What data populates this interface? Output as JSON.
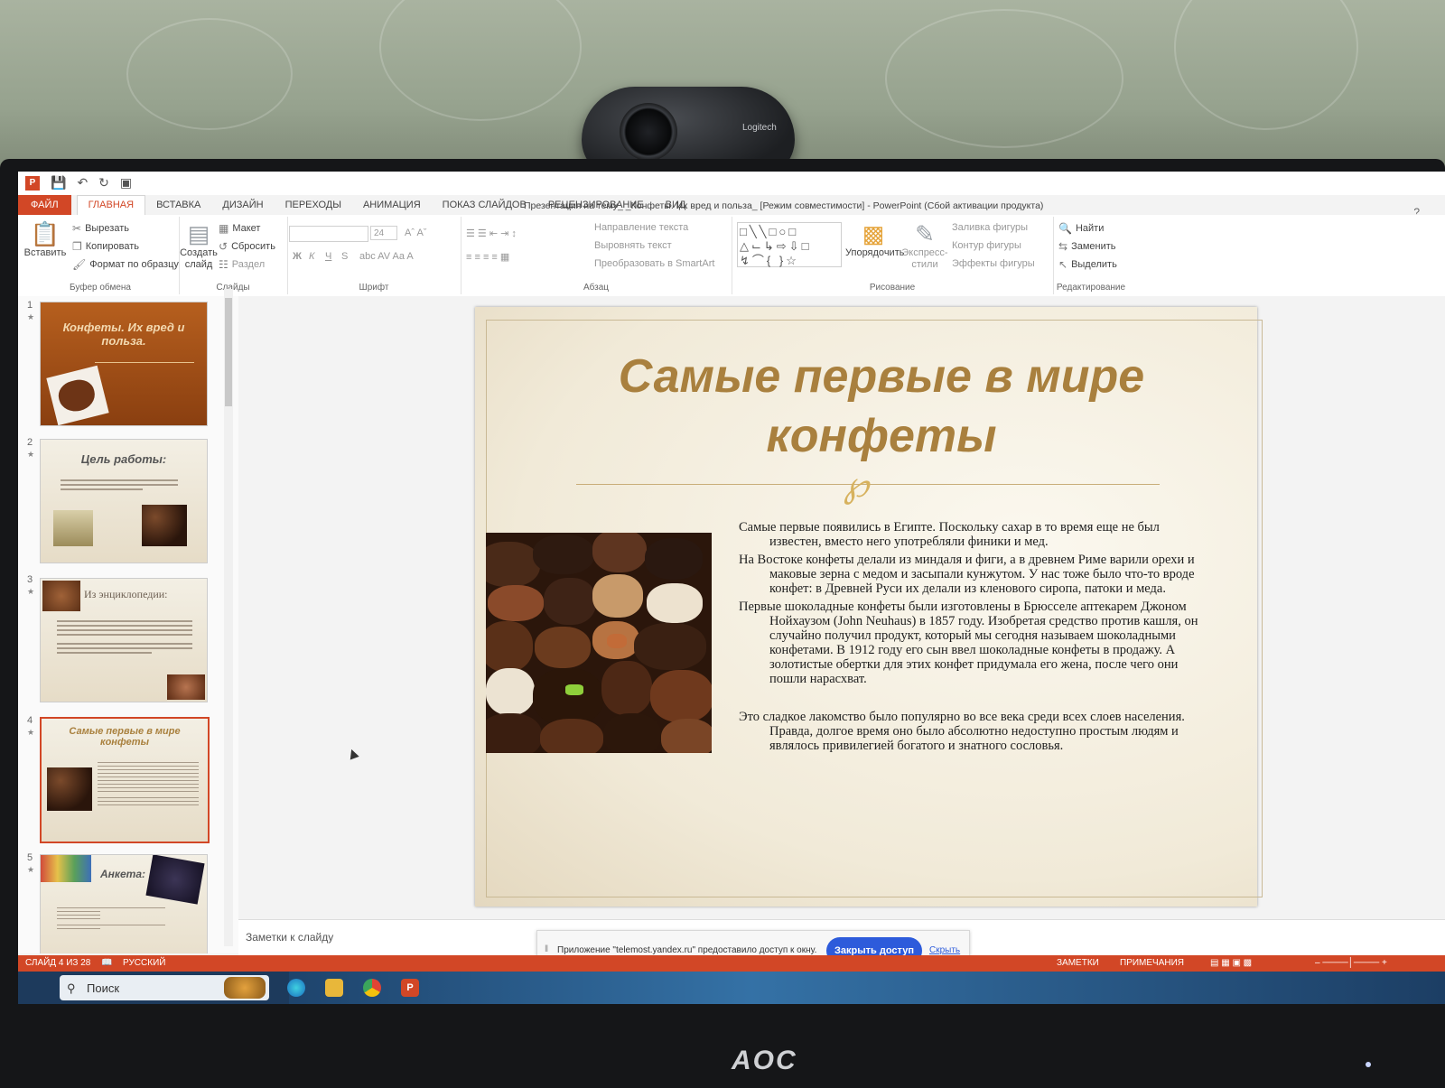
{
  "window": {
    "title": "Презентация на тему_ _Конфеты. Их вред и польза_ [Режим совместимости] - PowerPoint (Сбой активации продукта)",
    "help": "?"
  },
  "tabs": [
    "ФАЙЛ",
    "ГЛАВНАЯ",
    "ВСТАВКА",
    "ДИЗАЙН",
    "ПЕРЕХОДЫ",
    "АНИМАЦИЯ",
    "ПОКАЗ СЛАЙДОВ",
    "РЕЦЕНЗИРОВАНИЕ",
    "ВИД"
  ],
  "ribbon": {
    "clipboard": {
      "paste": "Вставить",
      "cut": "Вырезать",
      "copy": "Копировать",
      "format": "Формат по образцу",
      "label": "Буфер обмена"
    },
    "slides": {
      "new": "Создать слайд",
      "layout": "Макет",
      "reset": "Сбросить",
      "section": "Раздел",
      "label": "Слайды"
    },
    "font": {
      "size": "24",
      "bold": "Ж",
      "italic": "К",
      "underline": "Ч",
      "strike": "S",
      "label": "Шрифт"
    },
    "paragraph": {
      "direction": "Направление текста",
      "align": "Выровнять текст",
      "smartart": "Преобразовать в SmartArt",
      "label": "Абзац"
    },
    "drawing": {
      "arrange": "Упорядочить",
      "styles": "Экспресс-стили",
      "fill": "Заливка фигуры",
      "outline": "Контур фигуры",
      "effects": "Эффекты фигуры",
      "label": "Рисование"
    },
    "editing": {
      "find": "Найти",
      "replace": "Заменить",
      "select": "Выделить",
      "label": "Редактирование"
    }
  },
  "thumbnails": [
    {
      "num": "1",
      "title": "Конфеты. Их вред и польза."
    },
    {
      "num": "2",
      "title": "Цель работы:"
    },
    {
      "num": "3",
      "title": "Из энциклопедии:"
    },
    {
      "num": "4",
      "title": "Самые первые в мире конфеты"
    },
    {
      "num": "5",
      "title": "Анкета:"
    }
  ],
  "slide": {
    "title": "Самые первые в мире конфеты",
    "paragraphs": [
      "Самые первые появились в Египте. Поскольку сахар в то время еще не был известен, вместо него употребляли финики и мед.",
      "На Востоке конфеты делали из миндаля и фиги, а в древнем Риме варили орехи и маковые зерна с медом и засыпали кунжутом. У нас тоже было что-то вроде конфет: в Древней Руси их делали из кленового сиропа, патоки и меда.",
      "Первые шоколадные конфеты были изготовлены в Брюсселе аптекарем Джоном Нойхаузом (John Neuhaus) в 1857 году. Изобретая средство против кашля, он случайно получил продукт, который мы сегодня называем шоколадными конфетами. В 1912 году его сын ввел шоколадные конфеты в продажу. А золотистые обертки для этих конфет придумала его жена, после чего они пошли нарасхват.",
      "Это сладкое лакомство было популярно во все века среди всех слоев населения. Правда, долгое время оно было абсолютно недоступно простым людям и являлось привилегией богатого и знатного сословья."
    ]
  },
  "notes": {
    "placeholder": "Заметки к слайду"
  },
  "share": {
    "text": "Приложение \"telemost.yandex.ru\" предоставило доступ к окну.",
    "button": "Закрыть доступ",
    "hide": "Скрыть"
  },
  "status": {
    "slide": "СЛАЙД 4 ИЗ 28",
    "language": "РУССКИЙ",
    "notes": "ЗАМЕТКИ",
    "comments": "ПРИМЕЧАНИЯ"
  },
  "taskbar": {
    "search": "Поиск"
  },
  "hardware": {
    "webcam_brand": "Logitech",
    "monitor_brand": "AOC"
  },
  "colors": {
    "accent": "#d24726",
    "title": "#a9803e",
    "share_button": "#2d5bdb"
  }
}
